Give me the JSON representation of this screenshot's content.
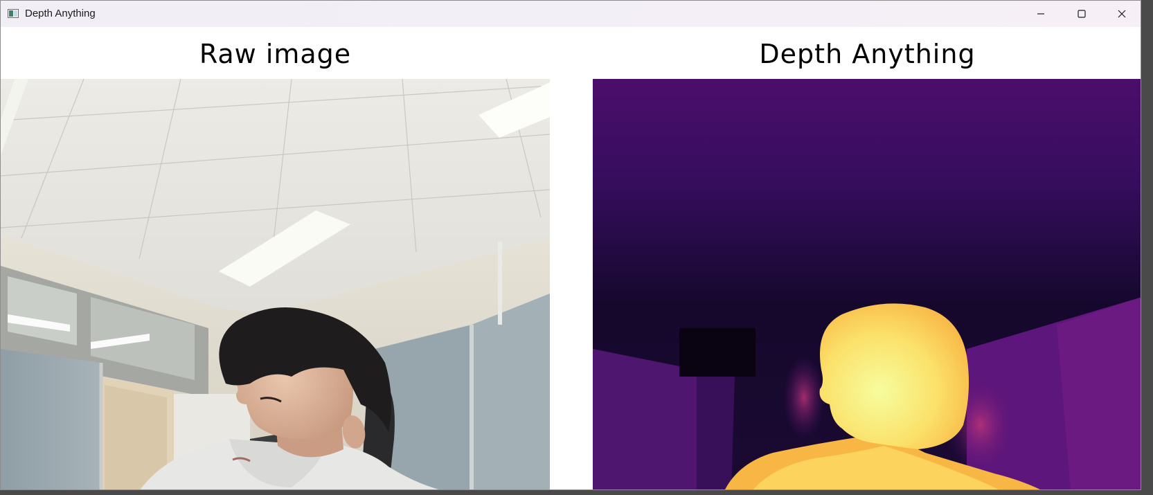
{
  "window": {
    "title": "Depth Anything",
    "controls": {
      "minimize": "minimize-icon",
      "maximize": "maximize-icon",
      "close": "close-icon"
    }
  },
  "panels": {
    "left": {
      "heading": "Raw image"
    },
    "right": {
      "heading": "Depth Anything"
    }
  },
  "colors": {
    "titlebar": "#f2eef6",
    "depth_far": "#1a0b3c",
    "depth_mid": "#5a1a7a",
    "depth_near": "#fbe67a"
  }
}
